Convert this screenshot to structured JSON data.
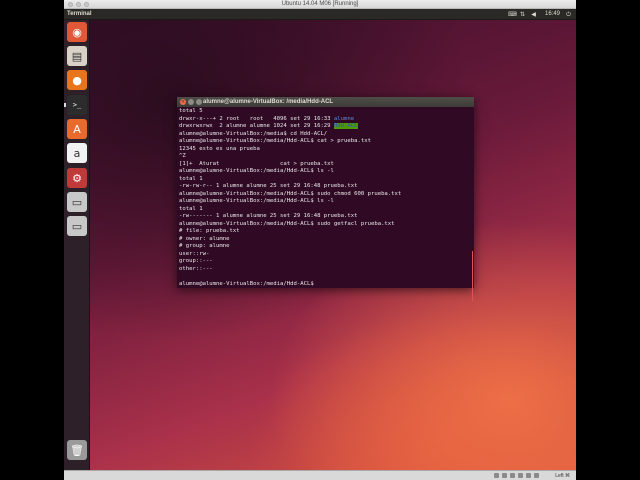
{
  "vbox": {
    "title": "Ubuntu 14.04 M06 [Running]",
    "status_key": "Left ⌘"
  },
  "panel": {
    "app_name": "Terminal",
    "clock": "16:49",
    "indicators": [
      "keyboard-icon",
      "network-icon",
      "volume-icon",
      "power-icon"
    ]
  },
  "launcher": {
    "items": [
      {
        "name": "ubuntu-dash-icon",
        "glyph": "◉",
        "color": "#e05836"
      },
      {
        "name": "files-icon",
        "glyph": "▤",
        "color": "#d9d3c7"
      },
      {
        "name": "firefox-icon",
        "glyph": "●",
        "color": "#e8741b"
      },
      {
        "name": "terminal-icon",
        "glyph": ">_",
        "color": "#2c2c2c"
      },
      {
        "name": "software-center-icon",
        "glyph": "A",
        "color": "#e86a2d"
      },
      {
        "name": "amazon-icon",
        "glyph": "a",
        "color": "#f2f2f2"
      },
      {
        "name": "system-settings-icon",
        "glyph": "⚙",
        "color": "#c03a3a"
      },
      {
        "name": "drive-icon",
        "glyph": "▭",
        "color": "#c8c8c8"
      },
      {
        "name": "usb-drive-icon",
        "glyph": "▭",
        "color": "#c8c8c8"
      },
      {
        "name": "trash-icon",
        "glyph": "🗑",
        "color": "#9a9a9a"
      }
    ]
  },
  "terminal": {
    "title": "alumne@alumne-VirtualBox: /media/Hdd-ACL",
    "lines": [
      "total 5",
      "drwxr-x---+ 2 root   root   4096 set 29 16:33 ",
      "drwxrwxrwx  2 alumne alumne 1024 set 29 16:29 ",
      "alumne@alumne-VirtualBox:/media$ cd Hdd-ACL/",
      "alumne@alumne-VirtualBox:/media/Hdd-ACL$ cat > prueba.txt",
      "12345 esto es una prueba",
      "^Z",
      "[1]+  Aturat                  cat > prueba.txt",
      "alumne@alumne-VirtualBox:/media/Hdd-ACL$ ls -l",
      "total 1",
      "-rw-rw-r-- 1 alumne alumne 25 set 29 16:48 prueba.txt",
      "alumne@alumne-VirtualBox:/media/Hdd-ACL$ sudo chmod 600 prueba.txt",
      "alumne@alumne-VirtualBox:/media/Hdd-ACL$ ls -l",
      "total 1",
      "-rw------- 1 alumne alumne 25 set 29 16:48 prueba.txt",
      "alumne@alumne-VirtualBox:/media/Hdd-ACL$ sudo getfacl prueba.txt",
      "# file: prueba.txt",
      "# owner: alumne",
      "# group: alumne",
      "user::rw-",
      "group::---",
      "other::---",
      "",
      "alumne@alumne-VirtualBox:/media/Hdd-ACL$ "
    ],
    "dir_alumne": "alumne",
    "dir_hdd": "Hdd-ACL"
  }
}
